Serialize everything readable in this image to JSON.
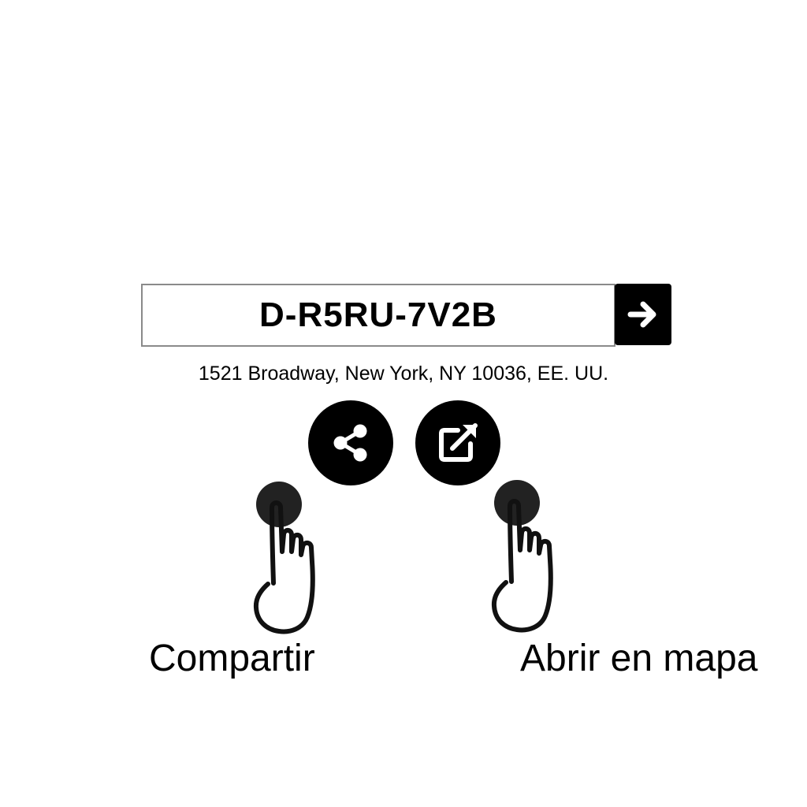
{
  "code_field": {
    "value": "D-R5RU-7V2B"
  },
  "go_button": {
    "icon": "arrow-right-icon"
  },
  "address": {
    "text": "1521 Broadway, New York, NY 10036, EE. UU."
  },
  "actions": {
    "share": {
      "icon": "share-icon",
      "caption": "Compartir"
    },
    "open_map": {
      "icon": "external-link-icon",
      "caption": "Abrir en mapa"
    }
  },
  "colors": {
    "button_bg": "#000000",
    "icon_fg": "#ffffff",
    "field_border": "#8a8a8a",
    "background": "#ffffff"
  }
}
